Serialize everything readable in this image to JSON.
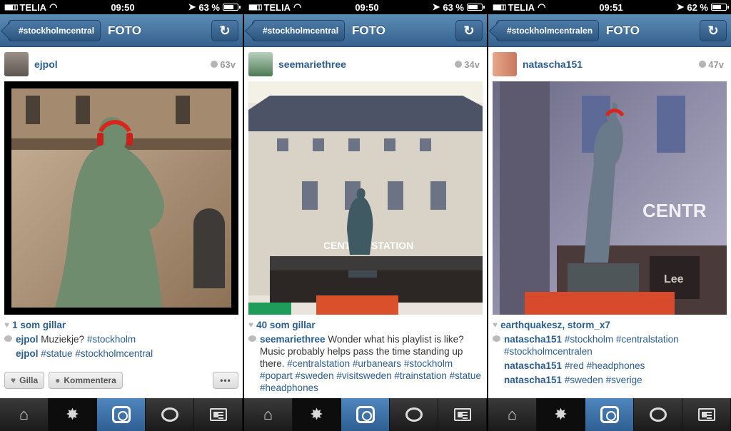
{
  "panels": [
    {
      "status": {
        "carrier": "TELIA",
        "time": "09:50",
        "battery": "63 %",
        "battery_level": 0.63
      },
      "nav": {
        "back": "#stockholmcentral",
        "title": "FOTO"
      },
      "post": {
        "username": "ejpol",
        "time": "63v"
      },
      "likes": "1 som gillar",
      "comments": [
        {
          "user": "ejpol",
          "text": "Muziekje?",
          "tags": "#stockholm"
        },
        {
          "user": "ejpol",
          "text": "",
          "tags": "#statue #stockholmcentral"
        }
      ],
      "actions": {
        "like": "Gilla",
        "comment": "Kommentera",
        "more": "•••"
      }
    },
    {
      "status": {
        "carrier": "TELIA",
        "time": "09:50",
        "battery": "63 %",
        "battery_level": 0.63
      },
      "nav": {
        "back": "#stockholmcentral",
        "title": "FOTO"
      },
      "post": {
        "username": "seemariethree",
        "time": "34v"
      },
      "likes": "40 som gillar",
      "comments": [
        {
          "user": "seemariethree",
          "text": "Wonder what his playlist is like? Music probably helps pass the time standing up there.",
          "tags": "#centralstation #urbanears #stockholm  #popart #sweden #visitsweden #trainstation #statue #headphones"
        }
      ]
    },
    {
      "status": {
        "carrier": "TELIA",
        "time": "09:51",
        "battery": "62 %",
        "battery_level": 0.62
      },
      "nav": {
        "back": "#stockholmcentralen",
        "title": "FOTO"
      },
      "post": {
        "username": "natascha151",
        "time": "47v"
      },
      "likes": "earthquakesz, storm_x7",
      "comments": [
        {
          "user": "natascha151",
          "text": "",
          "tags": "#stockholm #centralstation #stockholmcentralen"
        },
        {
          "user": "natascha151",
          "text": "",
          "tags": "#red #headphones"
        },
        {
          "user": "natascha151",
          "text": "",
          "tags": "#sweden #sverige"
        }
      ]
    }
  ],
  "photo_signs": {
    "p2": "CENTRALSTATION",
    "p3_sign": "CENTR",
    "p3_shop": "Lee"
  },
  "tabs": [
    "home-icon",
    "explore-icon",
    "camera-icon",
    "news-icon",
    "profile-icon"
  ],
  "colors": {
    "nav": "#35628e",
    "link": "#2b5d8f",
    "tab_active": "#3e74aa"
  }
}
